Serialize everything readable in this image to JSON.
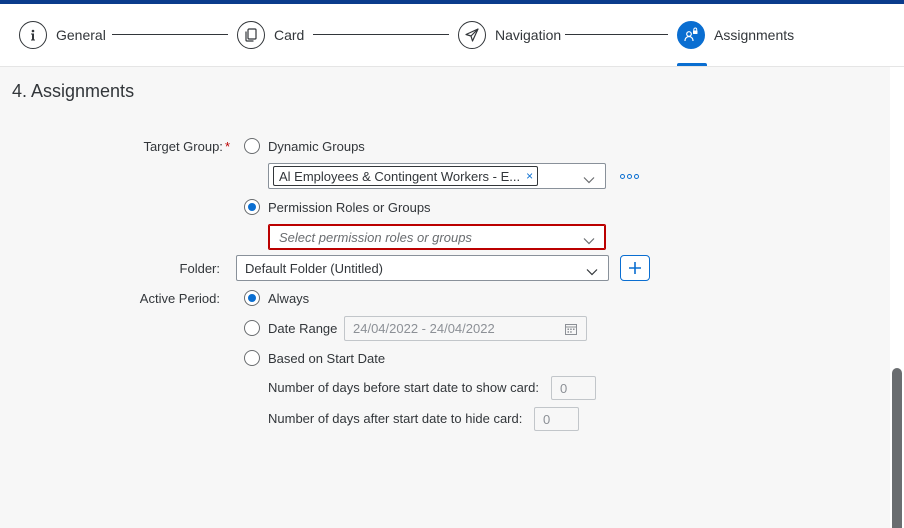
{
  "wizard": {
    "steps": [
      {
        "label": "General",
        "icon": "info-icon",
        "active": false
      },
      {
        "label": "Card",
        "icon": "copy-card-icon",
        "active": false
      },
      {
        "label": "Navigation",
        "icon": "paper-plane-icon",
        "active": false
      },
      {
        "label": "Assignments",
        "icon": "person-lock-icon",
        "active": true
      }
    ],
    "accent": "#0a6ed1"
  },
  "section": {
    "title": "4. Assignments"
  },
  "form": {
    "target_group_label": "Target Group:",
    "required_marker": "*",
    "dynamic_groups_label": "Dynamic Groups",
    "dynamic_groups_token": "Al Employees & Contingent Workers - E...",
    "token_remove": "×",
    "permission_label": "Permission Roles or Groups",
    "permission_placeholder": "Select permission roles or groups",
    "folder_label": "Folder:",
    "folder_value": "Default Folder (Untitled)",
    "active_period_label": "Active Period:",
    "always_label": "Always",
    "date_range_label": "Date Range",
    "date_range_value": "24/04/2022 - 24/04/2022",
    "start_date_label": "Based on Start Date",
    "days_before_label": "Number of days before start date to show card:",
    "days_before_value": "0",
    "days_after_label": "Number of days after start date to hide card:",
    "days_after_value": "0"
  }
}
